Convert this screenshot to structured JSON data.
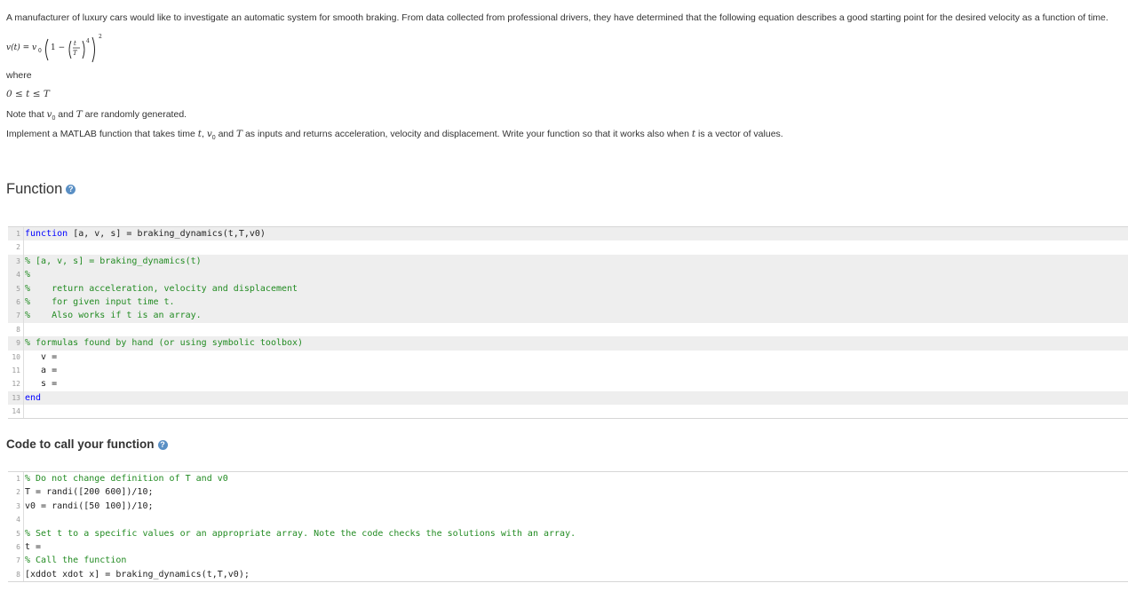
{
  "intro": "A manufacturer of luxury cars would like to investigate an automatic system for smooth braking. From data collected from professional drivers, they have determined that the following equation describes a good starting point for the desired velocity as a function of time.",
  "equation": {
    "lhs": "v(t) = v",
    "sub0": "0",
    "one_minus": "1 −",
    "t": "t",
    "T": "T",
    "pow4": "4",
    "pow2": "2"
  },
  "where_label": "where",
  "range": "0 ≤ t ≤ T",
  "note": {
    "pre": "Note that ",
    "v0": "v",
    "v0_sub": "0",
    "and": " and ",
    "T": "T",
    "post": " are randomly generated."
  },
  "implement": {
    "pre": "Implement a MATLAB function that takes time ",
    "t": "t",
    "comma": ", ",
    "v0": "v",
    "v0_sub": "0",
    "and": " and ",
    "T": "T",
    "mid": " as inputs and returns acceleration, velocity and displacement. Write your function so that it works also when ",
    "t2": "t",
    "post": " is a vector of values."
  },
  "function_heading": "Function",
  "call_heading": "Code to call your function",
  "function_code": [
    {
      "n": "1",
      "text": "function [a, v, s] = braking_dynamics(t,T,v0)",
      "ro": true,
      "kind": "fn"
    },
    {
      "n": "2",
      "text": "",
      "ro": false,
      "kind": "plain"
    },
    {
      "n": "3",
      "text": "% [a, v, s] = braking_dynamics(t)",
      "ro": true,
      "kind": "cm"
    },
    {
      "n": "4",
      "text": "%",
      "ro": true,
      "kind": "cm"
    },
    {
      "n": "5",
      "text": "%    return acceleration, velocity and displacement",
      "ro": true,
      "kind": "cm"
    },
    {
      "n": "6",
      "text": "%    for given input time t.",
      "ro": true,
      "kind": "cm"
    },
    {
      "n": "7",
      "text": "%    Also works if t is an array.",
      "ro": true,
      "kind": "cm"
    },
    {
      "n": "8",
      "text": "",
      "ro": false,
      "kind": "plain"
    },
    {
      "n": "9",
      "text": "% formulas found by hand (or using symbolic toolbox)",
      "ro": true,
      "kind": "cm"
    },
    {
      "n": "10",
      "text": "   v =",
      "ro": false,
      "kind": "plain"
    },
    {
      "n": "11",
      "text": "   a =",
      "ro": false,
      "kind": "plain"
    },
    {
      "n": "12",
      "text": "   s =",
      "ro": false,
      "kind": "plain"
    },
    {
      "n": "13",
      "text": "end",
      "ro": true,
      "kind": "kw"
    },
    {
      "n": "14",
      "text": "",
      "ro": false,
      "kind": "plain"
    }
  ],
  "call_code": [
    {
      "n": "1",
      "text": "% Do not change definition of T and v0",
      "ro": false,
      "kind": "cm"
    },
    {
      "n": "2",
      "text": "T = randi([200 600])/10;",
      "ro": false,
      "kind": "plain"
    },
    {
      "n": "3",
      "text": "v0 = randi([50 100])/10;",
      "ro": false,
      "kind": "plain"
    },
    {
      "n": "4",
      "text": "",
      "ro": false,
      "kind": "plain"
    },
    {
      "n": "5",
      "text": "% Set t to a specific values or an appropriate array. Note the code checks the solutions with an array.",
      "ro": false,
      "kind": "cm"
    },
    {
      "n": "6",
      "text": "t =",
      "ro": false,
      "kind": "plain"
    },
    {
      "n": "7",
      "text": "% Call the function",
      "ro": false,
      "kind": "cm"
    },
    {
      "n": "8",
      "text": "[xddot xdot x] = braking_dynamics(t,T,v0);",
      "ro": false,
      "kind": "plain"
    }
  ]
}
